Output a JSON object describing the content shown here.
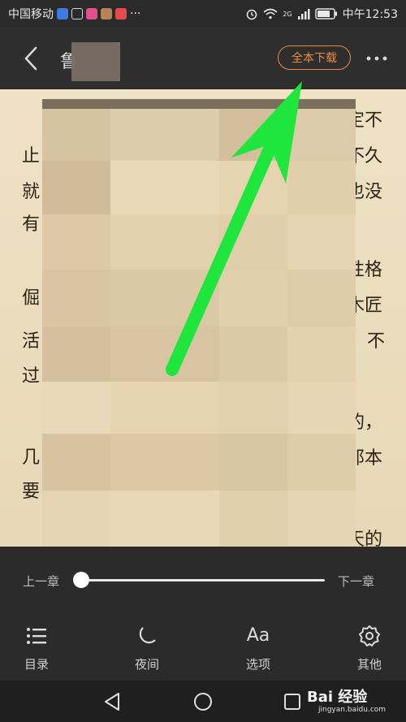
{
  "status_bar": {
    "carrier": "中国移动",
    "more": "···",
    "network": "2G",
    "time": "中午12:53"
  },
  "app_bar": {
    "title": "鲁",
    "download_button": "全本下载",
    "back_icon": "chevron-left-icon",
    "more_icon": "more-dots-icon"
  },
  "reading": {
    "left_chars": [
      "止",
      "就",
      "有",
      "倔",
      "活",
      "过",
      "几",
      "要"
    ],
    "right_chars": [
      "定不",
      "不久",
      "也没",
      "性格",
      "木匠",
      "不",
      "的，",
      "那本"
    ],
    "last_line_right": "天的"
  },
  "controls": {
    "prev_chapter": "上一章",
    "next_chapter": "下一章",
    "progress": 0
  },
  "bottom_menu": [
    {
      "label": "目录",
      "icon": "list-icon"
    },
    {
      "label": "夜间",
      "icon": "moon-icon"
    },
    {
      "label": "选项",
      "icon": "font-options-icon",
      "glyph": "Aa"
    },
    {
      "label": "其他",
      "icon": "gear-icon"
    }
  ],
  "watermark": {
    "text": "Bai 经验",
    "sub": "jingyan.baidu.com"
  },
  "colors": {
    "accent": "#f08a3c",
    "arrow": "#1ee63c",
    "page_bg": "#efe2c5"
  }
}
